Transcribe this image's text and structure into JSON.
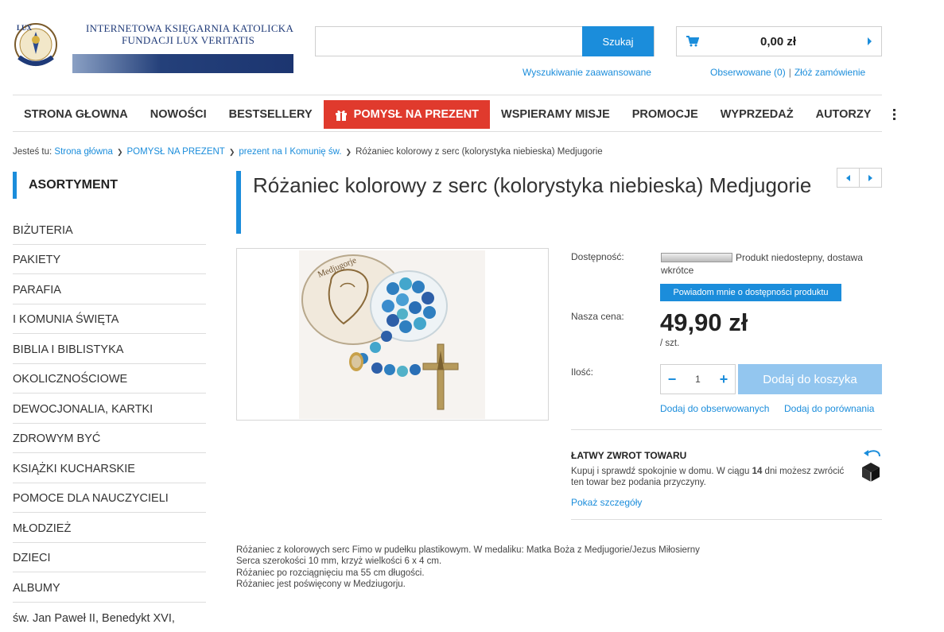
{
  "header": {
    "logo_line1": "INTERNETOWA KSIĘGARNIA KATOLICKA",
    "logo_line2": "FUNDACJI LUX VERITATIS",
    "logo_seal_text": "LUX VERITATIS",
    "search_placeholder": "",
    "search_button": "Szukaj",
    "advanced_search": "Wyszukiwanie zaawansowane",
    "cart_amount": "0,00 zł",
    "watched": "Obserwowane (0)",
    "link_sep": "|",
    "place_order": "Złóż zamówienie"
  },
  "nav": {
    "items": [
      "STRONA GŁOWNA",
      "NOWOŚCI",
      "BESTSELLERY",
      "POMYSŁ NA PREZENT",
      "WSPIERAMY MISJE",
      "PROMOCJE",
      "WYPRZEDAŻ",
      "AUTORZY"
    ],
    "more_icon": "vertical-dots-icon"
  },
  "breadcrumb": {
    "prefix": "Jesteś tu:",
    "links": [
      "Strona główna",
      "POMYSŁ NA PREZENT",
      "prezent na I Komunię św."
    ],
    "current": "Różaniec kolorowy z serc (kolorystyka niebieska) Medjugorie"
  },
  "sidebar": {
    "heading": "ASORTYMENT",
    "categories": [
      "BIŻUTERIA",
      "PAKIETY",
      "PARAFIA",
      "I KOMUNIA ŚWIĘTA",
      "BIBLIA I BIBLISTYKA",
      "OKOLICZNOŚCIOWE",
      "DEWOCJONALIA, KARTKI",
      "ZDROWYM BYĆ",
      "KSIĄŻKI KUCHARSKIE",
      "POMOCE DLA NAUCZYCIELI",
      "MŁODZIEŻ",
      "DZIECI",
      "ALBUMY",
      "św. Jan Paweł II, Benedykt XVI,"
    ]
  },
  "product": {
    "title": "Różaniec kolorowy z serc (kolorystyka niebieska) Medjugorie",
    "image_caption": "Medjugorje",
    "availability_label": "Dostępność:",
    "availability_text": "Produkt niedostepny, dostawa wkrótce",
    "notify_button": "Powiadom mnie o dostępności produktu",
    "price_label": "Nasza cena:",
    "price": "49,90 zł",
    "unit": "/ szt.",
    "qty_label": "Ilość:",
    "qty_value": "1",
    "qty_minus": "−",
    "qty_plus": "+",
    "add_to_cart": "Dodaj do koszyka",
    "add_to_watched": "Dodaj do obserwowanych",
    "add_to_compare": "Dodaj do porównania"
  },
  "returns": {
    "heading": "ŁATWY ZWROT TOWARU",
    "text_before": "Kupuj i sprawdź spokojnie w domu. W ciągu ",
    "days": "14",
    "text_after": " dni możesz zwrócić ten towar bez podania przyczyny.",
    "link": "Pokaż szczegóły"
  },
  "description": {
    "lines": [
      "Różaniec z kolorowych serc Fimo w pudełku plastikowym. W medaliku: Matka Boża z Medjugorie/Jezus Miłosierny",
      "Serca szerokości 10 mm, krzyż wielkości 6 x 4 cm.",
      "Różaniec po rozciągnięciu ma 55 cm długości.",
      "Różaniec jest poświęcony w Medziugorju."
    ]
  },
  "colors": {
    "accent": "#1b8ddb",
    "gift_red": "#e03a2d",
    "disabled_button": "#93c6ef",
    "logo_blue": "#1f3a78"
  }
}
